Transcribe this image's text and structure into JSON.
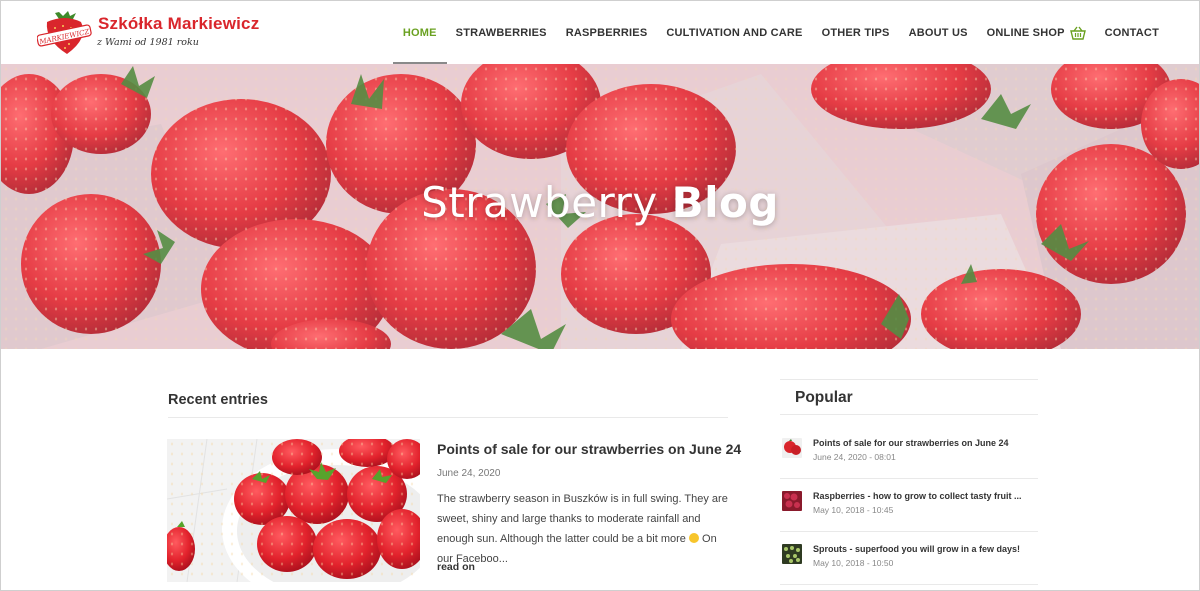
{
  "brand": {
    "name": "Szkółka Markiewicz",
    "tagline": "z Wami od 1981 roku",
    "badge_text": "MARKIEWICZ",
    "primary_color": "#d9262c",
    "accent_color": "#6aa121"
  },
  "nav": {
    "items": [
      {
        "label": "HOME",
        "active": true
      },
      {
        "label": "STRAWBERRIES",
        "active": false
      },
      {
        "label": "RASPBERRIES",
        "active": false
      },
      {
        "label": "CULTIVATION AND CARE",
        "active": false
      },
      {
        "label": "OTHER TIPS",
        "active": false
      },
      {
        "label": "ABOUT US",
        "active": false
      },
      {
        "label": "ONLINE SHOP",
        "active": false,
        "icon": "shopping-basket-icon"
      },
      {
        "label": "CONTACT",
        "active": false
      }
    ]
  },
  "hero": {
    "title_light": "Strawberry",
    "title_bold": "Blog"
  },
  "recent": {
    "heading": "Recent entries",
    "post": {
      "title": "Points of sale for our strawberries on June 24",
      "date": "June 24, 2020",
      "excerpt_before": "The strawberry season in Buszków is in full swing. They are sweet, shiny and large thanks to moderate rainfall and enough sun. Although the latter could be a bit more",
      "excerpt_after": " On our Faceboo...",
      "read_more": "read on"
    }
  },
  "popular": {
    "heading": "Popular",
    "items": [
      {
        "title": "Points of sale for our strawberries on June 24",
        "date": "June 24, 2020 - 08:01",
        "thumb": "strawberries"
      },
      {
        "title": "Raspberries - how to grow to collect tasty fruit ...",
        "date": "May 10, 2018 - 10:45",
        "thumb": "raspberries"
      },
      {
        "title": "Sprouts - superfood you will grow in a few days!",
        "date": "May 10, 2018 - 10:50",
        "thumb": "sprouts"
      }
    ]
  }
}
